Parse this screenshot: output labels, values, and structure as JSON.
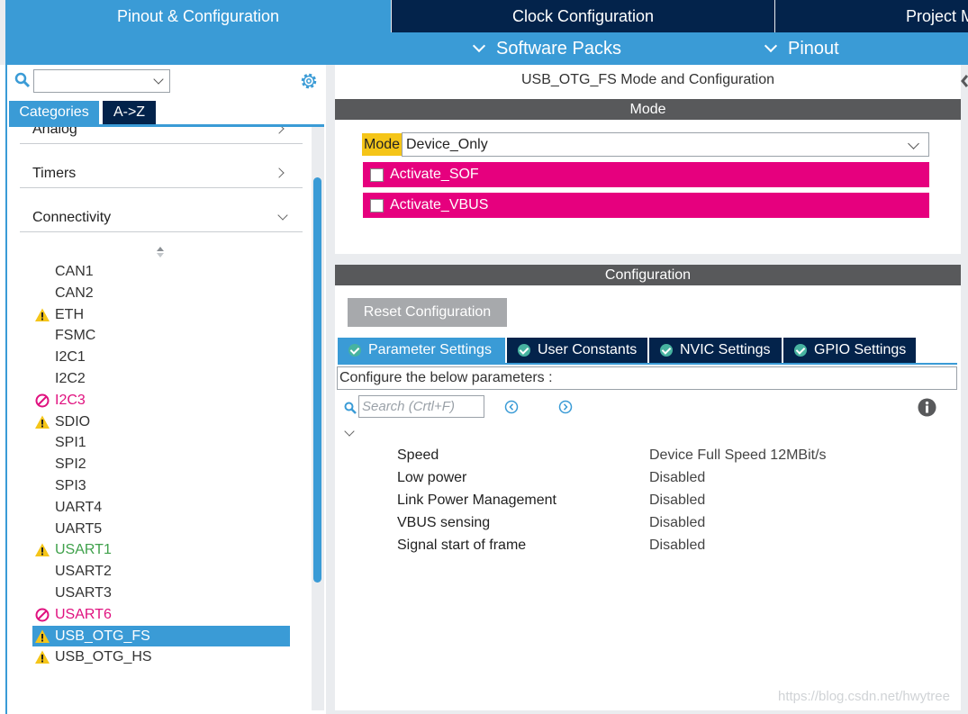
{
  "top_tabs": {
    "pinout_config": "Pinout & Configuration",
    "clock_config": "Clock Configuration",
    "project": "Project M"
  },
  "sub_menu": {
    "software_packs": "Software Packs",
    "pinout": "Pinout"
  },
  "left_panel": {
    "search_value": "",
    "tabs": {
      "categories": "Categories",
      "az": "A->Z"
    },
    "categories": {
      "analog": "Analog",
      "timers": "Timers",
      "connectivity": "Connectivity"
    },
    "peripherals": [
      {
        "label": "CAN1",
        "status": "none"
      },
      {
        "label": "CAN2",
        "status": "none"
      },
      {
        "label": "ETH",
        "status": "warning"
      },
      {
        "label": "FSMC",
        "status": "none"
      },
      {
        "label": "I2C1",
        "status": "none"
      },
      {
        "label": "I2C2",
        "status": "none"
      },
      {
        "label": "I2C3",
        "status": "disabled"
      },
      {
        "label": "SDIO",
        "status": "warning"
      },
      {
        "label": "SPI1",
        "status": "none"
      },
      {
        "label": "SPI2",
        "status": "none"
      },
      {
        "label": "SPI3",
        "status": "none"
      },
      {
        "label": "UART4",
        "status": "none"
      },
      {
        "label": "UART5",
        "status": "none"
      },
      {
        "label": "USART1",
        "status": "warning-configured"
      },
      {
        "label": "USART2",
        "status": "none"
      },
      {
        "label": "USART3",
        "status": "none"
      },
      {
        "label": "USART6",
        "status": "disabled"
      },
      {
        "label": "USB_OTG_FS",
        "status": "warning-selected"
      },
      {
        "label": "USB_OTG_HS",
        "status": "warning"
      }
    ]
  },
  "mode_panel": {
    "title": "USB_OTG_FS Mode and Configuration",
    "header": "Mode",
    "mode_label": "Mode",
    "mode_value": "Device_Only",
    "checkboxes": [
      {
        "label": "Activate_SOF",
        "checked": false
      },
      {
        "label": "Activate_VBUS",
        "checked": false
      }
    ]
  },
  "config_panel": {
    "header": "Configuration",
    "reset_button": "Reset Configuration",
    "tabs": {
      "parameter_settings": "Parameter Settings",
      "user_constants": "User Constants",
      "nvic_settings": "NVIC Settings",
      "gpio_settings": "GPIO Settings"
    },
    "description": "Configure the below parameters :",
    "search_placeholder": "Search (Crtl+F)",
    "parameters": [
      {
        "name": "Speed",
        "value": "Device Full Speed 12MBit/s"
      },
      {
        "name": "Low power",
        "value": "Disabled"
      },
      {
        "name": "Link Power Management",
        "value": "Disabled"
      },
      {
        "name": "VBUS sensing",
        "value": "Disabled"
      },
      {
        "name": "Signal start of frame",
        "value": "Disabled"
      }
    ]
  },
  "watermark": "https://blog.csdn.net/hwytree",
  "colors": {
    "accent_blue": "#3a9bd6",
    "navy": "#03234b",
    "magenta": "#e6007e",
    "mode_yellow": "#f5c518",
    "warning_yellow": "#f5c518",
    "configured_green": "#3fa14b"
  }
}
